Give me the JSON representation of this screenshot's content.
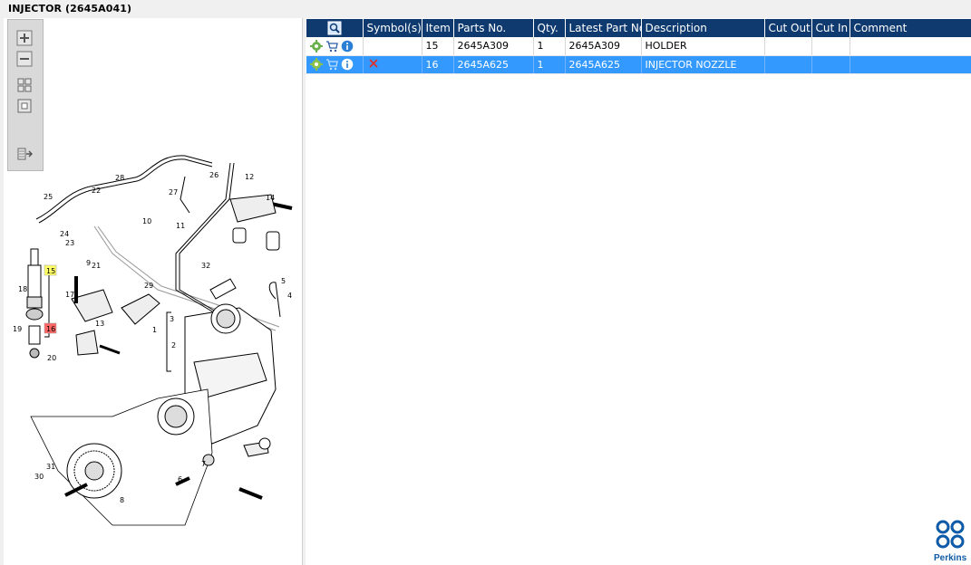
{
  "window": {
    "title": "INJECTOR (2645A041)"
  },
  "toolbar": {
    "zoom_in": "zoom-in",
    "zoom_out": "zoom-out",
    "fit": "fit-all",
    "actual": "actual-size",
    "export": "export"
  },
  "diagram": {
    "callouts": [
      "28",
      "26",
      "12",
      "25",
      "22",
      "27",
      "14",
      "24",
      "10",
      "23",
      "11",
      "9",
      "21",
      "15",
      "32",
      "5",
      "4",
      "18",
      "17",
      "29",
      "3",
      "1",
      "16",
      "19",
      "13",
      "2",
      "20",
      "30",
      "31",
      "7",
      "6",
      "8"
    ],
    "highlight_yellow": "15",
    "highlight_red": "16"
  },
  "table": {
    "columns": [
      "",
      "Symbol(s)",
      "Item",
      "Parts No.",
      "Qty.",
      "Latest Part No.",
      "Description",
      "Cut Out",
      "Cut In",
      "Comment"
    ],
    "rows": [
      {
        "symbols": [
          "gear-icon",
          "cart-icon",
          "info-icon"
        ],
        "mark": "",
        "item": "15",
        "part_no": "2645A309",
        "qty": "1",
        "latest": "2645A309",
        "description": "HOLDER",
        "cut_out": "",
        "cut_in": "",
        "comment": ""
      },
      {
        "symbols": [
          "gear-icon",
          "cart-icon",
          "info-icon"
        ],
        "mark": "x",
        "item": "16",
        "part_no": "2645A625",
        "qty": "1",
        "latest": "2645A625",
        "description": "INJECTOR NOZZLE",
        "cut_out": "",
        "cut_in": "",
        "comment": ""
      }
    ]
  },
  "brand": {
    "name": "Perkins",
    "color": "#0e5aa7"
  },
  "colors": {
    "header": "#0e3a70",
    "selected": "#3399ff",
    "highlight_yellow": "#ffff66",
    "highlight_red": "#ff6666"
  }
}
